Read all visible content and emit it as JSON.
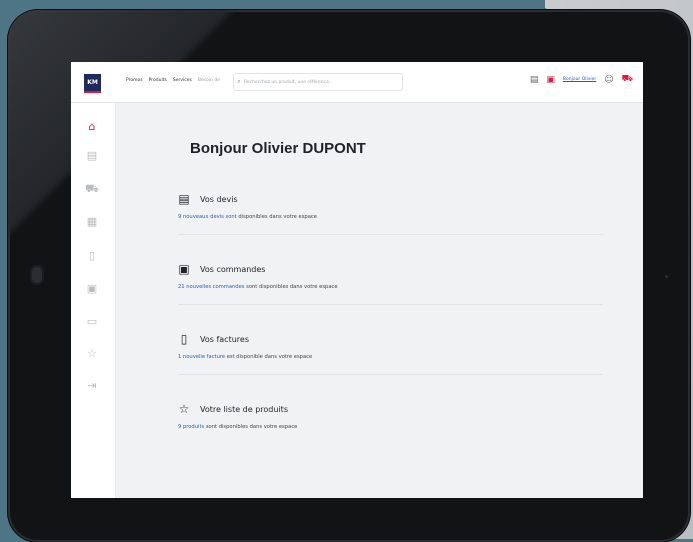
{
  "header": {
    "logo_text": "KM",
    "nav": [
      "Promos",
      "Produits",
      "Services",
      "Besoin de"
    ],
    "search_placeholder": "Recherchez un produit, une référence...",
    "account_link": "Bonjour Olivier"
  },
  "page": {
    "title": "Bonjour Olivier DUPONT"
  },
  "sections": [
    {
      "title": "Vos devis",
      "link_text": "9 nouveaux devis sont",
      "rest_text": " disponibles dans votre espace"
    },
    {
      "title": "Vos commandes",
      "link_text": "21 nouvelles commandes",
      "rest_text": " sont disponibles dans votre espace"
    },
    {
      "title": "Vos factures",
      "link_text": "1 nouvelle facture",
      "rest_text": " est disponible dans votre espace"
    },
    {
      "title": "Votre liste de produits",
      "link_text": "9 produits",
      "rest_text": " sont disponibles dans votre espace"
    }
  ],
  "sidebar_icons": [
    "home-icon",
    "quote-icon",
    "truck-icon",
    "grid-icon",
    "invoice-icon",
    "box-icon",
    "document-icon",
    "star-icon",
    "logout-icon"
  ],
  "colors": {
    "accent": "#e3173e",
    "brand": "#1d2a5b",
    "link": "#2a5db0",
    "background": "#4d7585"
  }
}
